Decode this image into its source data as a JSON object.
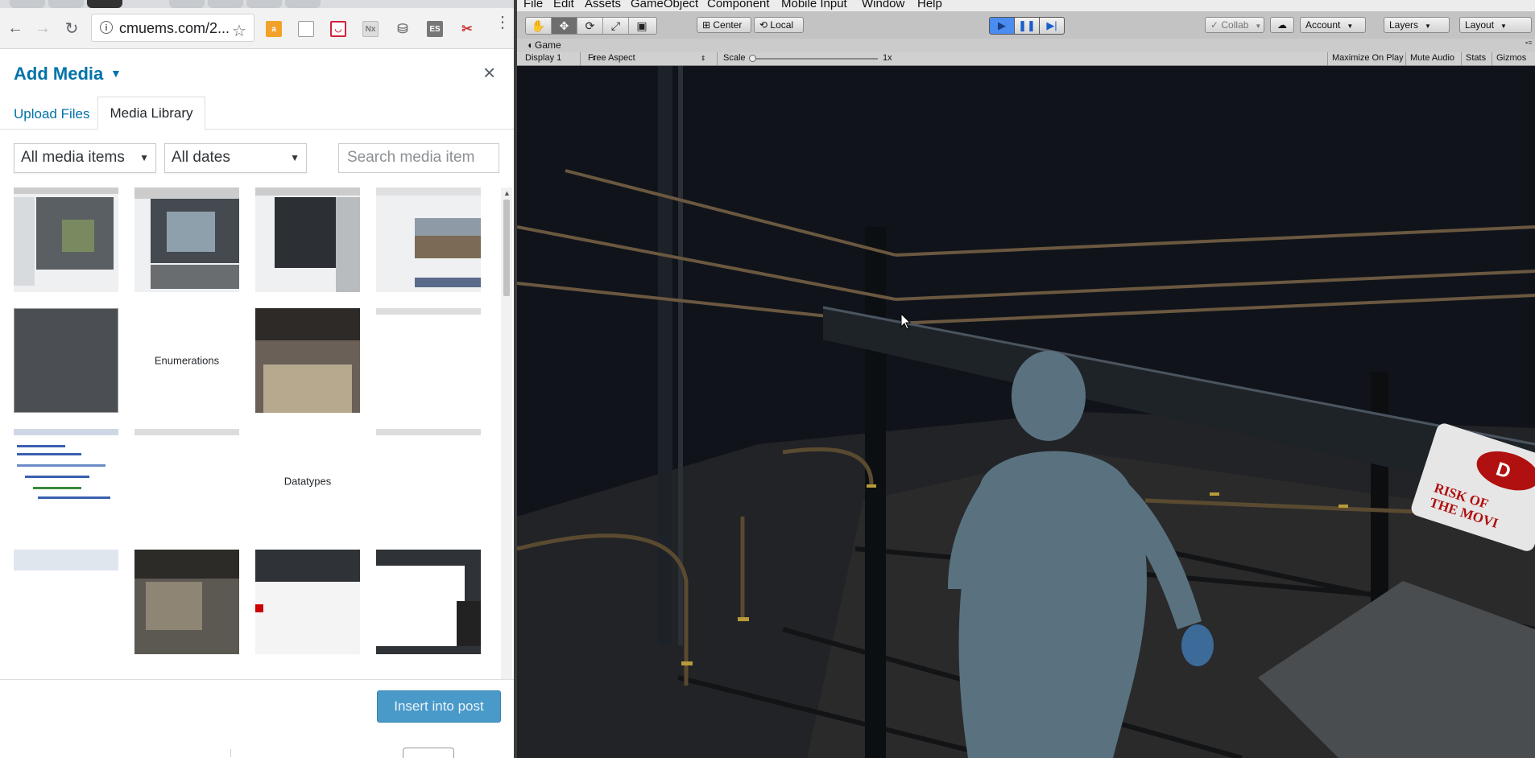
{
  "browser": {
    "url": "cmuems.com/2...",
    "extensions": [
      "amazon-icon",
      "page-icon",
      "pocket-icon",
      "nx-icon",
      "database-icon",
      "es-icon",
      "scissors-icon"
    ]
  },
  "modal": {
    "title": "Add Media",
    "close": "×",
    "tabs": {
      "upload": "Upload Files",
      "library": "Media Library"
    },
    "filters": {
      "type": "All media items",
      "date": "All dates"
    },
    "search_placeholder": "Search media item",
    "items": [
      {
        "kind": "screenshot"
      },
      {
        "kind": "screenshot"
      },
      {
        "kind": "screenshot"
      },
      {
        "kind": "screenshot"
      },
      {
        "kind": "screenshot"
      },
      {
        "kind": "document",
        "label": "Enumerations"
      },
      {
        "kind": "photo"
      },
      {
        "kind": "screenshot"
      },
      {
        "kind": "code"
      },
      {
        "kind": "screenshot"
      },
      {
        "kind": "document",
        "label": "Datatypes"
      },
      {
        "kind": "screenshot"
      },
      {
        "kind": "screenshot"
      },
      {
        "kind": "photo"
      },
      {
        "kind": "screenshot"
      },
      {
        "kind": "screenshot"
      }
    ],
    "insert_button": "Insert into post"
  },
  "unity": {
    "menus": [
      "File",
      "Edit",
      "Assets",
      "GameObject",
      "Component",
      "Mobile Input",
      "Window",
      "Help"
    ],
    "pivot": "Center",
    "space": "Local",
    "collab": "Collab",
    "account": "Account",
    "layers": "Layers",
    "layout": "Layout",
    "game_tab": "Game",
    "display": "Display 1",
    "aspect": "Free Aspect",
    "scale_label": "Scale",
    "scale_value": "1x",
    "toggles": [
      "Maximize On Play",
      "Mute Audio",
      "Stats",
      "Gizmos"
    ],
    "sign_text": [
      "RISK OF",
      "THE MOVI"
    ],
    "sign_logo": "D"
  },
  "colors": {
    "wp_blue": "#0073aa",
    "unity_play_active": "#4a8cf0"
  }
}
